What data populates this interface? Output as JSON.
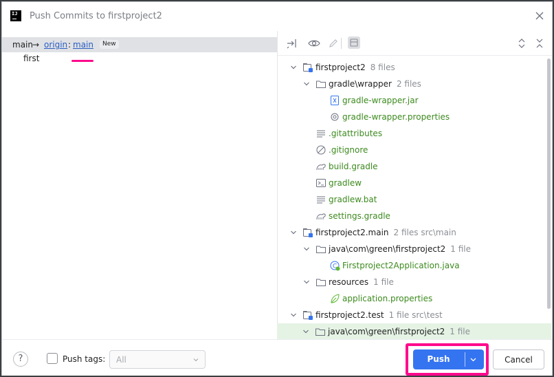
{
  "window": {
    "title": "Push Commits to firstproject2"
  },
  "left": {
    "local_branch": "main",
    "arrow": "→",
    "remote": "origin",
    "colon": ":",
    "remote_branch": "main",
    "new_badge": "New",
    "commits": [
      "first"
    ]
  },
  "tree": [
    {
      "label": "firstproject2",
      "meta": "8 files",
      "icon": "module-folder-icon",
      "color": "dark",
      "expanded": true
    },
    {
      "label": "gradle\\wrapper",
      "meta": "2 files",
      "icon": "folder-icon",
      "color": "dark",
      "expanded": true
    },
    {
      "label": "gradle-wrapper.jar",
      "meta": "",
      "icon": "jar-file-icon",
      "color": "green"
    },
    {
      "label": "gradle-wrapper.properties",
      "meta": "",
      "icon": "gear-file-icon",
      "color": "green"
    },
    {
      "label": ".gitattributes",
      "meta": "",
      "icon": "text-file-icon",
      "color": "green"
    },
    {
      "label": ".gitignore",
      "meta": "",
      "icon": "ignore-file-icon",
      "color": "green"
    },
    {
      "label": "build.gradle",
      "meta": "",
      "icon": "gradle-icon",
      "color": "green"
    },
    {
      "label": "gradlew",
      "meta": "",
      "icon": "terminal-file-icon",
      "color": "green"
    },
    {
      "label": "gradlew.bat",
      "meta": "",
      "icon": "text-file-icon",
      "color": "green"
    },
    {
      "label": "settings.gradle",
      "meta": "",
      "icon": "gradle-icon",
      "color": "green"
    },
    {
      "label": "firstproject2.main",
      "meta": "2 files  src\\main",
      "icon": "module-folder-icon",
      "color": "dark",
      "expanded": true
    },
    {
      "label": "java\\com\\green\\firstproject2",
      "meta": "1 file",
      "icon": "folder-icon",
      "color": "dark",
      "expanded": true
    },
    {
      "label": "Firstproject2Application.java",
      "meta": "",
      "icon": "spring-class-icon",
      "color": "green"
    },
    {
      "label": "resources",
      "meta": "1 file",
      "icon": "folder-icon",
      "color": "dark",
      "expanded": true
    },
    {
      "label": "application.properties",
      "meta": "",
      "icon": "spring-leaf-icon",
      "color": "green"
    },
    {
      "label": "firstproject2.test",
      "meta": "1 file  src\\test",
      "icon": "module-folder-icon",
      "color": "dark",
      "expanded": true
    },
    {
      "label": "java\\com\\green\\firstproject2",
      "meta": "1 file",
      "icon": "folder-icon",
      "color": "dark",
      "expanded": true,
      "selected": true
    }
  ],
  "bottom": {
    "help": "?",
    "push_tags_label": "Push tags:",
    "tags_value": "All",
    "push_label": "Push",
    "cancel_label": "Cancel"
  },
  "colors": {
    "accent": "#3574f0",
    "added_file": "#3c8a1e",
    "highlight": "#ff0a8c",
    "link": "#2a5ec2"
  }
}
